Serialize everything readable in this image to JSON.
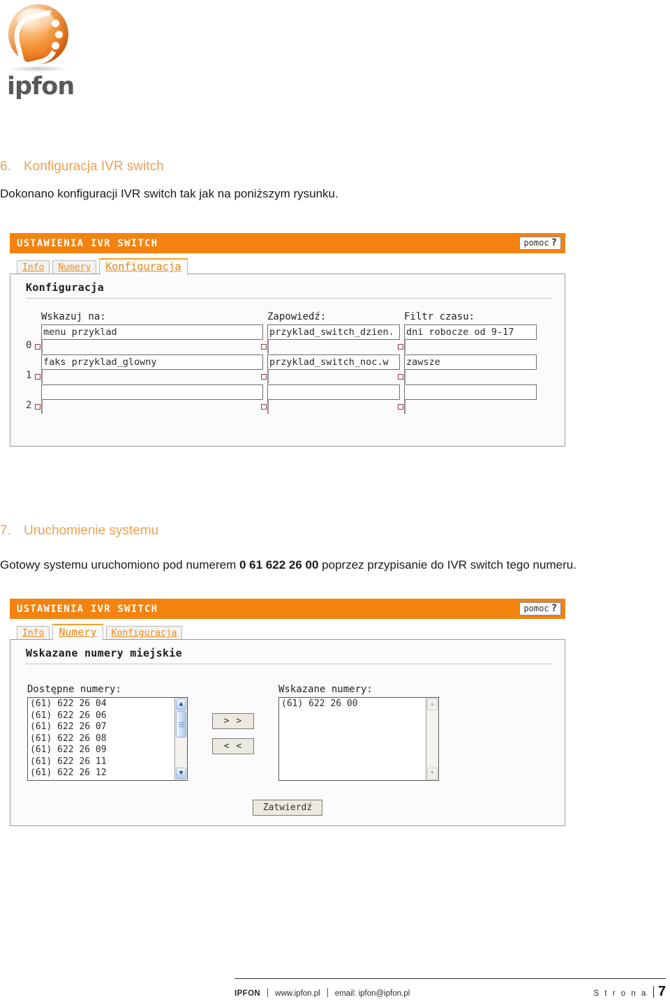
{
  "logo": {
    "wordmark": "ipfon"
  },
  "document": {
    "section6": {
      "number": "6.",
      "title": "Konfiguracja IVR switch",
      "paragraph": "Dokonano konfiguracji IVR switch tak jak na poniższym rysunku."
    },
    "section7": {
      "number": "7.",
      "title": "Uruchomienie systemu",
      "paragraph_before": "Gotowy systemu uruchomiono pod numerem ",
      "number_bold": "0 61 622 26 00",
      "paragraph_after": " poprzez przypisanie do IVR switch tego numeru."
    }
  },
  "app_config": {
    "titlebar": "USTAWIENIA IVR SWITCH",
    "help_label": "pomoc",
    "help_mark": "?",
    "tabs": [
      {
        "label": "Info",
        "active": false
      },
      {
        "label": "Numery",
        "active": false
      },
      {
        "label": "Konfiguracja",
        "active": true
      }
    ],
    "section_title": "Konfiguracja",
    "columns": [
      "Wskazuj na:",
      "Zapowiedź:",
      "Filtr czasu:"
    ],
    "rows": [
      {
        "index": "0",
        "target": "menu przyklad",
        "announcement": "przyklad_switch_dzien.",
        "time_filter": "dni robocze od 9-17"
      },
      {
        "index": "1",
        "target": "faks przyklad_glowny",
        "announcement": "przyklad_switch_noc.w",
        "time_filter": "zawsze"
      },
      {
        "index": "2",
        "target": "",
        "announcement": "",
        "time_filter": ""
      }
    ]
  },
  "app_numery": {
    "titlebar": "USTAWIENIA IVR SWITCH",
    "help_label": "pomoc",
    "help_mark": "?",
    "tabs": [
      {
        "label": "Info",
        "active": false
      },
      {
        "label": "Numery",
        "active": true
      },
      {
        "label": "Konfiguracja",
        "active": false
      }
    ],
    "section_title": "Wskazane numery miejskie",
    "available_label": "Dostępne numery:",
    "available_numbers": [
      "(61) 622 26 04",
      "(61) 622 26 06",
      "(61) 622 26 07",
      "(61) 622 26 08",
      "(61) 622 26 09",
      "(61) 622 26 11",
      "(61) 622 26 12"
    ],
    "assigned_label": "Wskazane numery:",
    "assigned_numbers": [
      "(61) 622 26 00"
    ],
    "add_button": "> >",
    "remove_button": "< <",
    "submit_button": "Zatwierdź"
  },
  "footer": {
    "brand": "IPFON",
    "website": "www.ipfon.pl",
    "email": "email: ipfon@ipfon.pl",
    "page_label": "S t r o n a",
    "page_number": "7"
  },
  "colors": {
    "accent_orange": "#f4820f",
    "heading_orange": "#f0a050",
    "tab_orange": "#ee8c1c"
  }
}
